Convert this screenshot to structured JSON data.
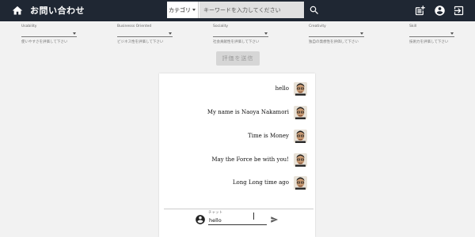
{
  "appbar": {
    "title": "お問い合わせ",
    "category_label": "カテゴリ",
    "search_placeholder": "キーワードを入力してください",
    "icons": [
      "home-icon",
      "search-icon",
      "add-post-icon",
      "account-icon",
      "logout-icon"
    ]
  },
  "evaluation": {
    "fields": [
      {
        "label": "Usability",
        "help": "使いやすさを評価して下さい"
      },
      {
        "label": "Businesss Oriented",
        "help": "ビジネス性を評価して下さい"
      },
      {
        "label": "Sociality",
        "help": "社会貢献性を評価して下さい"
      },
      {
        "label": "Creativity",
        "help": "独自の発想性を評価して下さい"
      },
      {
        "label": "Skill",
        "help": "技術力を評価して下さい"
      }
    ],
    "submit_label": "評価を送信"
  },
  "chat": {
    "messages": [
      {
        "text": "hello"
      },
      {
        "text": "My name is Naoya Nakamori"
      },
      {
        "text": "Time is Money"
      },
      {
        "text": "May the Force be with you!"
      },
      {
        "text": "Long Long time ago"
      }
    ],
    "input_label": "チャット",
    "input_value": "hello"
  },
  "colors": {
    "appbar": "#1f2733",
    "page_bg": "#f2f2f2",
    "button_disabled": "#d6d6d6"
  }
}
